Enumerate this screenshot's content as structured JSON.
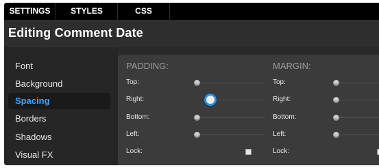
{
  "tabs": [
    {
      "label": "SETTINGS"
    },
    {
      "label": "STYLES"
    },
    {
      "label": "CSS"
    }
  ],
  "header": {
    "title": "Editing Comment Date"
  },
  "sidebar": {
    "items": [
      {
        "label": "Font"
      },
      {
        "label": "Background"
      },
      {
        "label": "Spacing"
      },
      {
        "label": "Borders"
      },
      {
        "label": "Shadows"
      },
      {
        "label": "Visual FX"
      }
    ],
    "active": "Spacing"
  },
  "padding": {
    "title": "PADDING:",
    "top_label": "Top:",
    "right_label": "Right:",
    "bottom_label": "Bottom:",
    "left_label": "Left:",
    "lock_label": "Lock:"
  },
  "margin": {
    "title": "MARGIN:",
    "top_label": "Top:",
    "right_label": "Right:",
    "bottom_label": "Bottom:",
    "left_label": "Left:",
    "lock_label": "Lock:"
  },
  "colors": {
    "accent": "#3fa6ff",
    "tabbar": "#000000",
    "panel": "#2a2a2a",
    "content": "#3b3b3b"
  }
}
